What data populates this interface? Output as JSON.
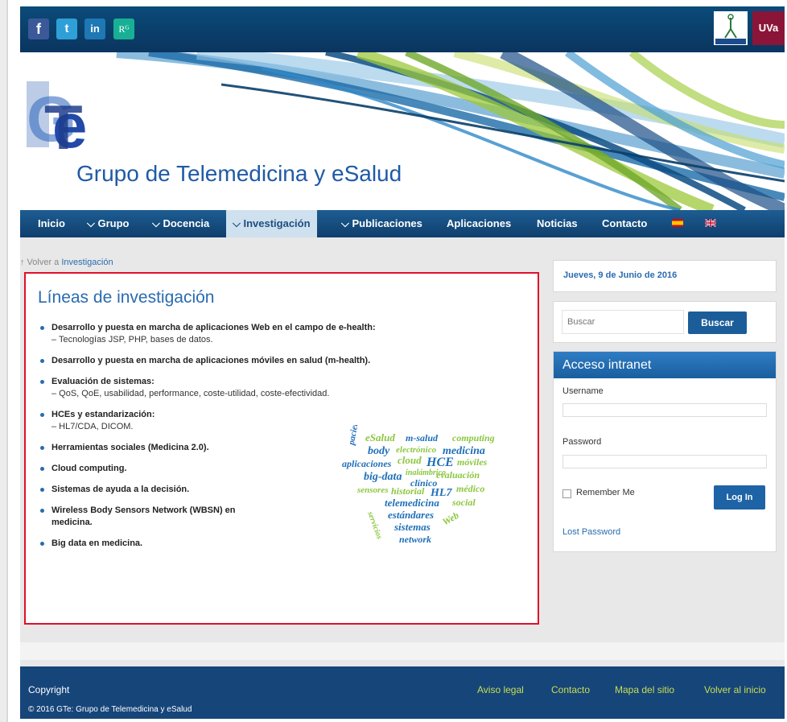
{
  "header": {
    "social": {
      "facebook": "f",
      "twitter": "t",
      "linkedin": "in",
      "researchgate": "Rᴳ"
    },
    "logo_etsit": "ETSIT UVa",
    "logo_uva": "UVa"
  },
  "banner": {
    "logo_text": "GTe",
    "site_title": "Grupo de Telemedicina y eSalud"
  },
  "nav": {
    "items": [
      {
        "label": "Inicio"
      },
      {
        "label": "⌵ Grupo"
      },
      {
        "label": "⌵ Docencia"
      },
      {
        "label": "⌵ Investigación"
      },
      {
        "label": "⌵ Publicaciones"
      },
      {
        "label": "Aplicaciones"
      },
      {
        "label": "Noticias"
      },
      {
        "label": "Contacto"
      }
    ],
    "active": "Investigación",
    "flags": [
      "es",
      "en"
    ]
  },
  "breadcrumb": {
    "prefix": "↑ Volver a",
    "link": "Investigación"
  },
  "content": {
    "title": "Líneas de investigación",
    "items": [
      {
        "text": "Desarrollo y puesta en marcha de aplicaciones Web en el campo de e-health:",
        "sub": "– Tecnologías JSP, PHP, bases de datos."
      },
      {
        "text": "Desarrollo y puesta en marcha de aplicaciones móviles en salud (m-health).",
        "sub": ""
      },
      {
        "text": "Evaluación de sistemas:",
        "sub": "– QoS, QoE, usabilidad, performance, coste-utilidad, coste-efectividad."
      },
      {
        "text": "HCEs y estandarización:",
        "sub": "– HL7/CDA, DICOM."
      },
      {
        "text": "Herramientas sociales (Medicina 2.0).",
        "sub": ""
      },
      {
        "text": "Cloud computing.",
        "sub": ""
      },
      {
        "text": "Sistemas de ayuda a la decisión.",
        "sub": ""
      },
      {
        "text": "Wireless Body Sensors Network (WBSN) en medicina.",
        "sub": ""
      },
      {
        "text": "Big data en medicina.",
        "sub": ""
      }
    ],
    "wordcloud": [
      "eSalud",
      "m-salud",
      "computing",
      "body",
      "electrónico",
      "medicina",
      "aplicaciones",
      "cloud",
      "HCE",
      "móviles",
      "big-data",
      "inalámbrico",
      "evaluación",
      "clínico",
      "sensores",
      "historial",
      "HL7",
      "médico",
      "telemedicina",
      "social",
      "estándares",
      "sistemas",
      "Web",
      "network",
      "paciente",
      "servicios"
    ]
  },
  "sidebar": {
    "date": "Jueves, 9 de Junio de 2016",
    "search": {
      "placeholder": "Buscar",
      "button": "Buscar"
    },
    "login": {
      "title": "Acceso intranet",
      "username_label": "Username",
      "password_label": "Password",
      "remember_label": "Remember Me",
      "login_button": "Log In",
      "lost_password": "Lost Password"
    }
  },
  "footer": {
    "copyright_heading": "Copyright",
    "copyright_line": "© 2016 GTe: Grupo de Telemedicina y eSalud",
    "links": [
      "Aviso legal",
      "Contacto",
      "Mapa del sitio",
      "Volver al inicio"
    ]
  },
  "colors": {
    "brand_blue": "#1f5aa6",
    "nav_dark": "#0f3e6c",
    "highlight_red": "#e0102a",
    "footer_link": "#c9de4f"
  }
}
